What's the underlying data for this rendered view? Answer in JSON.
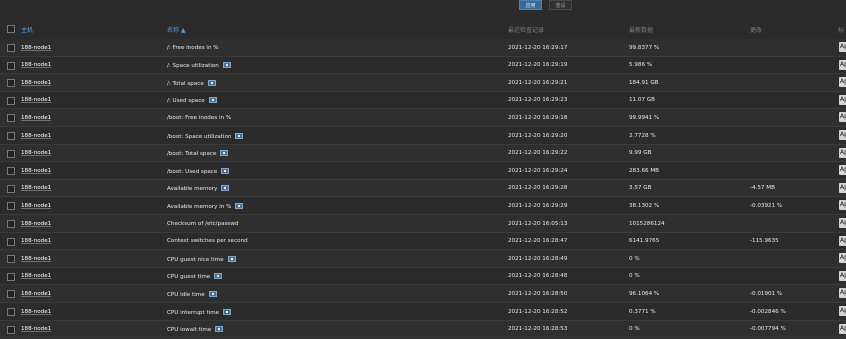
{
  "filters": {
    "apply_label": "应用",
    "reset_label": "重设"
  },
  "table": {
    "headers": {
      "host": "主机",
      "name": "名称 ▲",
      "last_check": "最近检查记录",
      "last_value": "最新数据",
      "change": "更改",
      "tags": "标"
    },
    "rows": [
      {
        "host": "188-node1",
        "item": "/: Free inodes in %",
        "has_icon": false,
        "timestamp": "2021-12-20 16:29:17",
        "value": "99.8377 %",
        "change": "",
        "tag": "Ap"
      },
      {
        "host": "188-node1",
        "item": "/: Space utilization",
        "has_icon": true,
        "timestamp": "2021-12-20 16:29:19",
        "value": "5.986 %",
        "change": "",
        "tag": "Ap"
      },
      {
        "host": "188-node1",
        "item": "/: Total space",
        "has_icon": true,
        "timestamp": "2021-12-20 16:29:21",
        "value": "184.91 GB",
        "change": "",
        "tag": "Ap"
      },
      {
        "host": "188-node1",
        "item": "/: Used space",
        "has_icon": true,
        "timestamp": "2021-12-20 16:29:23",
        "value": "11.07 GB",
        "change": "",
        "tag": "Ap"
      },
      {
        "host": "188-node1",
        "item": "/boot: Free inodes in %",
        "has_icon": false,
        "timestamp": "2021-12-20 16:29:18",
        "value": "99.9941 %",
        "change": "",
        "tag": "Ap"
      },
      {
        "host": "188-node1",
        "item": "/boot: Space utilization",
        "has_icon": true,
        "timestamp": "2021-12-20 16:29:20",
        "value": "2.7728 %",
        "change": "",
        "tag": "Ap"
      },
      {
        "host": "188-node1",
        "item": "/boot: Total space",
        "has_icon": true,
        "timestamp": "2021-12-20 16:29:22",
        "value": "9.99 GB",
        "change": "",
        "tag": "Ap"
      },
      {
        "host": "188-node1",
        "item": "/boot: Used space",
        "has_icon": true,
        "timestamp": "2021-12-20 16:29:24",
        "value": "283.66 MB",
        "change": "",
        "tag": "Ap"
      },
      {
        "host": "188-node1",
        "item": "Available memory",
        "has_icon": true,
        "timestamp": "2021-12-20 16:29:28",
        "value": "3.57 GB",
        "change": "-4.57 MB",
        "tag": "Ap"
      },
      {
        "host": "188-node1",
        "item": "Available memory in %",
        "has_icon": true,
        "timestamp": "2021-12-20 16:29:29",
        "value": "38.1302 %",
        "change": "-0.03921 %",
        "tag": "Ap"
      },
      {
        "host": "188-node1",
        "item": "Checksum of /etc/passwd",
        "has_icon": false,
        "timestamp": "2021-12-20 16:05:13",
        "value": "1015286124",
        "change": "",
        "tag": "Ap"
      },
      {
        "host": "188-node1",
        "item": "Context switches per second",
        "has_icon": false,
        "timestamp": "2021-12-20 16:28:47",
        "value": "6141.9765",
        "change": "-115.9635",
        "tag": "Ap"
      },
      {
        "host": "188-node1",
        "item": "CPU guest nice time",
        "has_icon": true,
        "timestamp": "2021-12-20 16:28:49",
        "value": "0 %",
        "change": "",
        "tag": "Ap"
      },
      {
        "host": "188-node1",
        "item": "CPU guest time",
        "has_icon": true,
        "timestamp": "2021-12-20 16:28:48",
        "value": "0 %",
        "change": "",
        "tag": "Ap"
      },
      {
        "host": "188-node1",
        "item": "CPU idle time",
        "has_icon": true,
        "timestamp": "2021-12-20 16:28:50",
        "value": "96.1064 %",
        "change": "-0.01901 %",
        "tag": "Ap"
      },
      {
        "host": "188-node1",
        "item": "CPU interrupt time",
        "has_icon": true,
        "timestamp": "2021-12-20 16:28:52",
        "value": "0.3771 %",
        "change": "-0.002846 %",
        "tag": "Ap"
      },
      {
        "host": "188-node1",
        "item": "CPU iowait time",
        "has_icon": true,
        "timestamp": "2021-12-20 16:28:53",
        "value": "0 %",
        "change": "-0.007794 %",
        "tag": "Ap"
      }
    ]
  }
}
